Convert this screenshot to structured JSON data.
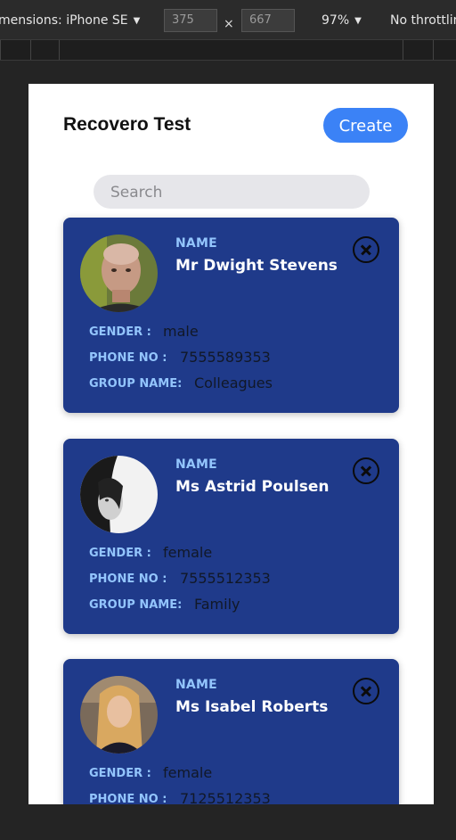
{
  "devtools": {
    "device": "mensions: iPhone SE",
    "width": "375",
    "height": "667",
    "separator": "×",
    "zoom": "97%",
    "throttle": "No throttlin"
  },
  "app": {
    "title": "Recovero Test",
    "create_label": "Create",
    "search_placeholder": "Search"
  },
  "labels": {
    "name": "NAME",
    "gender": "GENDER :",
    "phone": "PHONE NO :",
    "group": "GROUP NAME:"
  },
  "contacts": [
    {
      "name": "Mr Dwight Stevens",
      "gender": "male",
      "phone": "7555589353",
      "group": "Colleagues"
    },
    {
      "name": "Ms Astrid Poulsen",
      "gender": "female",
      "phone": "7555512353",
      "group": "Family"
    },
    {
      "name": "Ms Isabel Roberts",
      "gender": "female",
      "phone": "7125512353",
      "group": ""
    }
  ],
  "colors": {
    "card": "#1f3a8a",
    "accent": "#3b82f6",
    "label": "#93c5fd"
  }
}
